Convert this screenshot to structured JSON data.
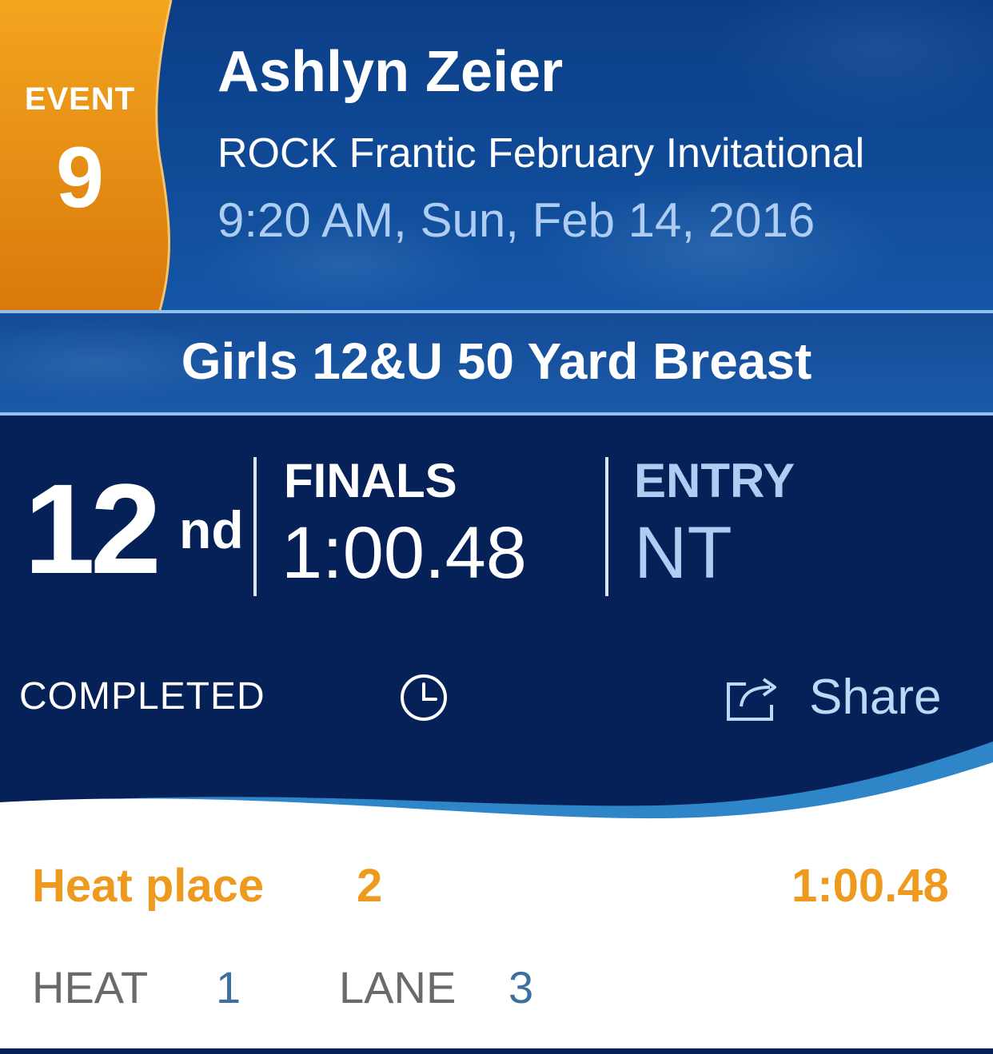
{
  "event": {
    "label": "EVENT",
    "number": "9",
    "colors": {
      "top": "#f3a51f",
      "bottom": "#d9790c",
      "edge": "#f6c46a"
    }
  },
  "swimmer": {
    "name": "Ashlyn Zeier",
    "meet": "ROCK Frantic February Invitational",
    "datetime": "9:20 AM, Sun, Feb 14, 2016"
  },
  "race": {
    "title": "Girls 12&U 50 Yard Breast"
  },
  "result": {
    "place": "12",
    "place_suffix": "nd",
    "finals_label": "FINALS",
    "finals_time": "1:00.48",
    "entry_label": "ENTRY",
    "entry_time": "NT",
    "status": "COMPLETED",
    "status_icon": "clock-icon",
    "share_label": "Share",
    "share_icon": "share-icon"
  },
  "heat": {
    "place_label": "Heat place",
    "place_value": "2",
    "time": "1:00.48",
    "heat_label": "HEAT",
    "heat_value": "1",
    "lane_label": "LANE",
    "lane_value": "3"
  },
  "colors": {
    "navy": "#062158",
    "header_blue": "#0b3d86",
    "accent_orange": "#ee9a1f",
    "light_blue_text": "#aecdf2",
    "wave_blue": "#2e86c8",
    "meta_label_gray": "#6a6a6a",
    "meta_value_blue": "#3d6fa0"
  }
}
